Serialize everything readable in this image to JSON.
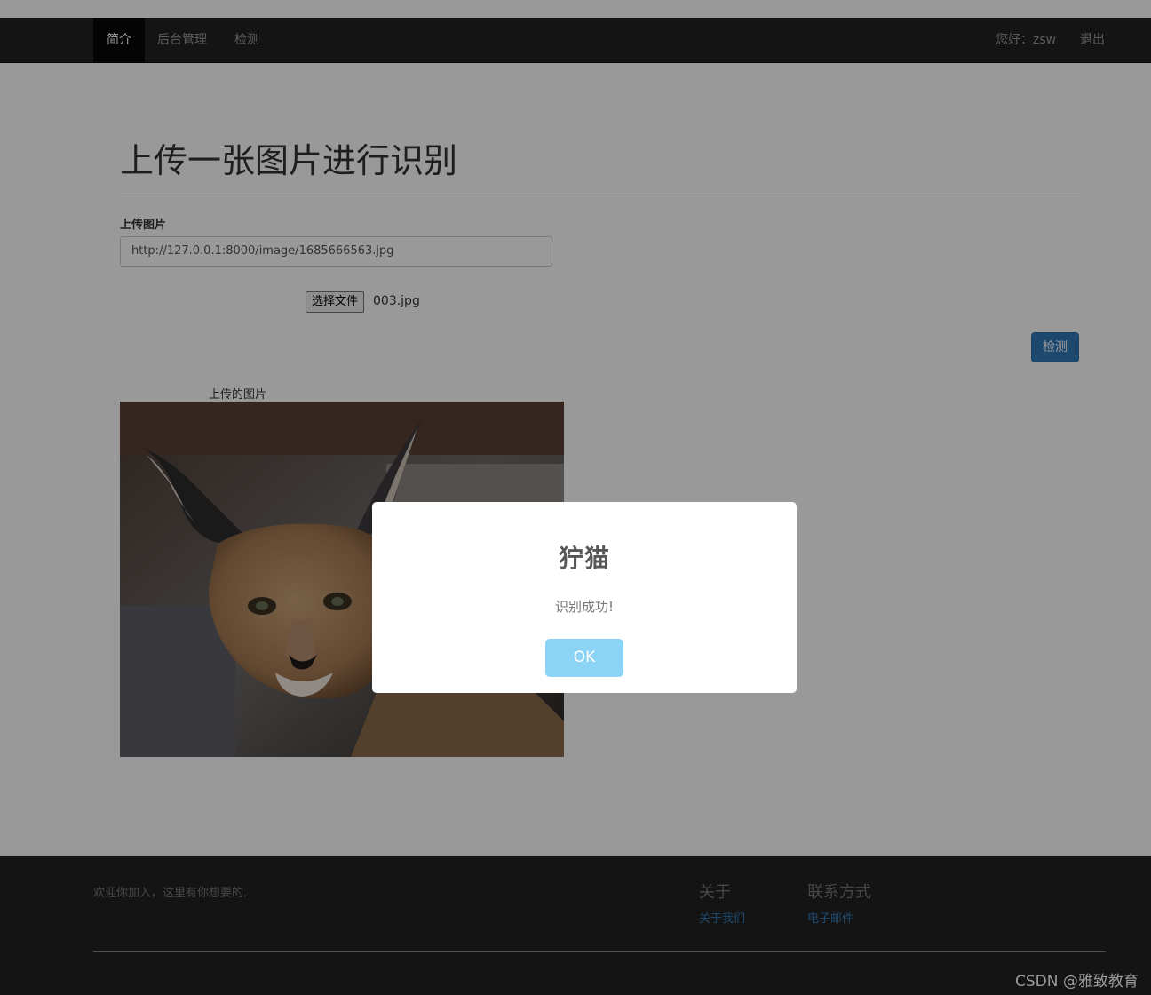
{
  "navbar": {
    "items": [
      {
        "label": "简介",
        "active": true
      },
      {
        "label": "后台管理",
        "active": false
      },
      {
        "label": "检测",
        "active": false
      }
    ],
    "greeting": "您好：zsw",
    "logout_label": "退出"
  },
  "main": {
    "title": "上传一张图片进行识别",
    "upload_label": "上传图片",
    "url_value": "http://127.0.0.1:8000/image/1685666563.jpg",
    "file_button_label": "选择文件",
    "file_name": "003.jpg",
    "detect_label": "检测",
    "image_caption": "上传的图片",
    "image_subject": "caracal photo"
  },
  "footer": {
    "welcome": "欢迎你加入，这里有你想要的.",
    "about_heading": "关于",
    "about_link": "关于我们",
    "contact_heading": "联系方式",
    "contact_link": "电子邮件",
    "watermark": "CSDN @雅致教育"
  },
  "modal": {
    "title": "狞猫",
    "text": "识别成功!",
    "ok_label": "OK"
  },
  "colors": {
    "navbar_bg": "#222222",
    "primary": "#337ab7",
    "ok_button": "#8cd4f5",
    "overlay": "rgba(0,0,0,0.4)"
  }
}
